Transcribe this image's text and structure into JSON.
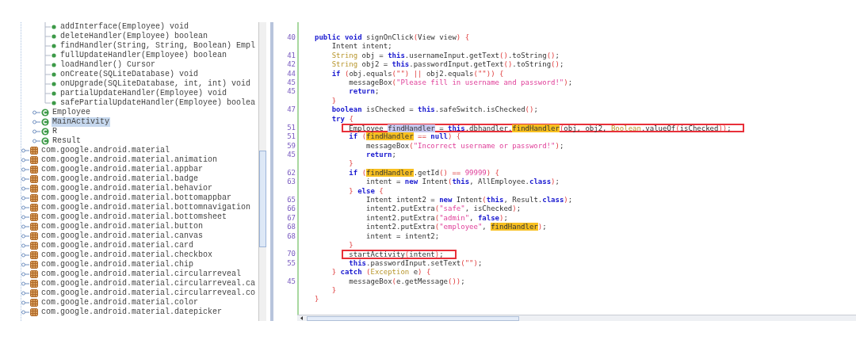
{
  "tree": {
    "items": [
      {
        "children": [
          {
            "children": [
              {
                "label": "addInterface(Employee) void",
                "kind": "method"
              },
              {
                "label": "deleteHandler(Employee) boolean",
                "kind": "method"
              },
              {
                "label": "findHandler(String, String, Boolean) Empl",
                "kind": "method"
              },
              {
                "label": "fullUpdateHandler(Employee) boolean",
                "kind": "method"
              },
              {
                "label": "loadHandler() Cursor",
                "kind": "method"
              },
              {
                "label": "onCreate(SQLiteDatabase) void",
                "kind": "method"
              },
              {
                "label": "onUpgrade(SQLiteDatabase, int, int) void",
                "kind": "method"
              },
              {
                "label": "partialUpdateHandler(Employee) void",
                "kind": "method"
              },
              {
                "label": "safePartialUpdateHandler(Employee) boolea",
                "kind": "method"
              }
            ]
          },
          {
            "label": "Employee",
            "kind": "class",
            "selected": false
          },
          {
            "label": "MainActivity",
            "kind": "class",
            "selected": true
          },
          {
            "label": "R",
            "kind": "class",
            "selected": false
          },
          {
            "label": "Result",
            "kind": "class",
            "selected": false
          }
        ]
      },
      {
        "label": "com.google.android.material",
        "kind": "package"
      },
      {
        "label": "com.google.android.material.animation",
        "kind": "package"
      },
      {
        "label": "com.google.android.material.appbar",
        "kind": "package"
      },
      {
        "label": "com.google.android.material.badge",
        "kind": "package"
      },
      {
        "label": "com.google.android.material.behavior",
        "kind": "package"
      },
      {
        "label": "com.google.android.material.bottomappbar",
        "kind": "package"
      },
      {
        "label": "com.google.android.material.bottomnavigation",
        "kind": "package"
      },
      {
        "label": "com.google.android.material.bottomsheet",
        "kind": "package"
      },
      {
        "label": "com.google.android.material.button",
        "kind": "package"
      },
      {
        "label": "com.google.android.material.canvas",
        "kind": "package"
      },
      {
        "label": "com.google.android.material.card",
        "kind": "package"
      },
      {
        "label": "com.google.android.material.checkbox",
        "kind": "package"
      },
      {
        "label": "com.google.android.material.chip",
        "kind": "package"
      },
      {
        "label": "com.google.android.material.circularreveal",
        "kind": "package"
      },
      {
        "label": "com.google.android.material.circularreveal.ca",
        "kind": "package"
      },
      {
        "label": "com.google.android.material.circularreveal.co",
        "kind": "package"
      },
      {
        "label": "com.google.android.material.color",
        "kind": "package"
      },
      {
        "label": "com.google.android.material.datepicker",
        "kind": "package"
      }
    ]
  },
  "code": {
    "lines": [
      {
        "number": "40",
        "boxed": false,
        "tokens": [
          {
            "text": "public void ",
            "kind": "keyword"
          },
          {
            "text": "signOnClick",
            "kind": "plain"
          },
          {
            "text": "(",
            "kind": "bracket"
          },
          {
            "text": "View view",
            "kind": "plain"
          },
          {
            "text": ") {",
            "kind": "bracket"
          }
        ]
      },
      {
        "boxed": false,
        "tokens": [
          {
            "text": "    Intent intent;",
            "kind": "plain"
          }
        ]
      },
      {
        "number": "41",
        "boxed": false,
        "tokens": [
          {
            "text": "    String",
            "kind": "type"
          },
          {
            "text": " obj = ",
            "kind": "plain"
          },
          {
            "text": "this",
            "kind": "keyword"
          },
          {
            "text": ".usernameInput.getText",
            "kind": "plain"
          },
          {
            "text": "()",
            "kind": "bracket"
          },
          {
            "text": ".toString",
            "kind": "plain"
          },
          {
            "text": "()",
            "kind": "bracket"
          },
          {
            "text": ";",
            "kind": "plain"
          }
        ]
      },
      {
        "number": "42",
        "boxed": false,
        "tokens": [
          {
            "text": "    String",
            "kind": "type"
          },
          {
            "text": " obj2 = ",
            "kind": "plain"
          },
          {
            "text": "this",
            "kind": "keyword"
          },
          {
            "text": ".passwordInput.getText",
            "kind": "plain"
          },
          {
            "text": "()",
            "kind": "bracket"
          },
          {
            "text": ".toString",
            "kind": "plain"
          },
          {
            "text": "()",
            "kind": "bracket"
          },
          {
            "text": ";",
            "kind": "plain"
          }
        ]
      },
      {
        "number": "44",
        "boxed": false,
        "tokens": [
          {
            "text": "    if ",
            "kind": "keyword"
          },
          {
            "text": "(",
            "kind": "bracket"
          },
          {
            "text": "obj.equals",
            "kind": "plain"
          },
          {
            "text": "(\"\") || ",
            "kind": "bracket"
          },
          {
            "text": "obj2.equals",
            "kind": "plain"
          },
          {
            "text": "(\"\")) {",
            "kind": "bracket"
          }
        ]
      },
      {
        "number": "45",
        "boxed": false,
        "tokens": [
          {
            "text": "        messageBox",
            "kind": "plain"
          },
          {
            "text": "(",
            "kind": "bracket"
          },
          {
            "text": "\"Please fill in username and password!\"",
            "kind": "string"
          },
          {
            "text": ")",
            "kind": "bracket"
          },
          {
            "text": ";",
            "kind": "plain"
          }
        ]
      },
      {
        "number": "45",
        "boxed": false,
        "tokens": [
          {
            "text": "        return",
            "kind": "keyword"
          },
          {
            "text": ";",
            "kind": "plain"
          }
        ]
      },
      {
        "boxed": false,
        "tokens": [
          {
            "text": "    }",
            "kind": "bracket"
          }
        ]
      },
      {
        "number": "47",
        "boxed": false,
        "tokens": [
          {
            "text": "    boolean",
            "kind": "keyword"
          },
          {
            "text": " isChecked = ",
            "kind": "plain"
          },
          {
            "text": "this",
            "kind": "keyword"
          },
          {
            "text": ".safeSwitch.isChecked",
            "kind": "plain"
          },
          {
            "text": "()",
            "kind": "bracket"
          },
          {
            "text": ";",
            "kind": "plain"
          }
        ]
      },
      {
        "boxed": false,
        "tokens": [
          {
            "text": "    try ",
            "kind": "keyword"
          },
          {
            "text": "{",
            "kind": "bracket"
          }
        ]
      },
      {
        "number": "51",
        "boxed": true,
        "tokens": [
          {
            "text": "        Employee ",
            "kind": "plain"
          },
          {
            "text": "findHandler",
            "kind": "selection"
          },
          {
            "text": " = ",
            "kind": "plain"
          },
          {
            "text": "this",
            "kind": "keyword"
          },
          {
            "text": ".dbhandler.",
            "kind": "plain"
          },
          {
            "text": "findHandler",
            "kind": "highlight"
          },
          {
            "text": "(",
            "kind": "bracket"
          },
          {
            "text": "obj, obj2, ",
            "kind": "plain"
          },
          {
            "text": "Boolean",
            "kind": "type"
          },
          {
            "text": ".valueOf",
            "kind": "plain"
          },
          {
            "text": "(",
            "kind": "bracket"
          },
          {
            "text": "isChecked",
            "kind": "plain"
          },
          {
            "text": "))",
            "kind": "bracket"
          },
          {
            "text": ";",
            "kind": "plain"
          }
        ]
      },
      {
        "number": "51",
        "boxed": false,
        "tokens": [
          {
            "text": "        if ",
            "kind": "keyword"
          },
          {
            "text": "(",
            "kind": "bracket"
          },
          {
            "text": "findHandler",
            "kind": "highlight"
          },
          {
            "text": " == ",
            "kind": "bracket"
          },
          {
            "text": "null",
            "kind": "keyword"
          },
          {
            "text": ") {",
            "kind": "bracket"
          }
        ]
      },
      {
        "number": "59",
        "boxed": false,
        "tokens": [
          {
            "text": "            messageBox",
            "kind": "plain"
          },
          {
            "text": "(",
            "kind": "bracket"
          },
          {
            "text": "\"Incorrect username or password!\"",
            "kind": "string"
          },
          {
            "text": ")",
            "kind": "bracket"
          },
          {
            "text": ";",
            "kind": "plain"
          }
        ]
      },
      {
        "number": "45",
        "boxed": false,
        "tokens": [
          {
            "text": "            return",
            "kind": "keyword"
          },
          {
            "text": ";",
            "kind": "plain"
          }
        ]
      },
      {
        "boxed": false,
        "tokens": [
          {
            "text": "        }",
            "kind": "bracket"
          }
        ]
      },
      {
        "number": "62",
        "boxed": false,
        "tokens": [
          {
            "text": "        if ",
            "kind": "keyword"
          },
          {
            "text": "(",
            "kind": "bracket"
          },
          {
            "text": "findHandler",
            "kind": "highlight"
          },
          {
            "text": ".getId",
            "kind": "plain"
          },
          {
            "text": "() == ",
            "kind": "bracket"
          },
          {
            "text": "99999",
            "kind": "number"
          },
          {
            "text": ") {",
            "kind": "bracket"
          }
        ]
      },
      {
        "number": "63",
        "boxed": false,
        "tokens": [
          {
            "text": "            intent = ",
            "kind": "plain"
          },
          {
            "text": "new ",
            "kind": "keyword"
          },
          {
            "text": "Intent",
            "kind": "plain"
          },
          {
            "text": "(",
            "kind": "bracket"
          },
          {
            "text": "this",
            "kind": "keyword"
          },
          {
            "text": ", AllEmployee.",
            "kind": "plain"
          },
          {
            "text": "class",
            "kind": "keyword"
          },
          {
            "text": ")",
            "kind": "bracket"
          },
          {
            "text": ";",
            "kind": "plain"
          }
        ]
      },
      {
        "boxed": false,
        "tokens": [
          {
            "text": "        } ",
            "kind": "bracket"
          },
          {
            "text": "else ",
            "kind": "keyword"
          },
          {
            "text": "{",
            "kind": "bracket"
          }
        ]
      },
      {
        "number": "65",
        "boxed": false,
        "tokens": [
          {
            "text": "            Intent intent2 = ",
            "kind": "plain"
          },
          {
            "text": "new ",
            "kind": "keyword"
          },
          {
            "text": "Intent",
            "kind": "plain"
          },
          {
            "text": "(",
            "kind": "bracket"
          },
          {
            "text": "this",
            "kind": "keyword"
          },
          {
            "text": ", Result.",
            "kind": "plain"
          },
          {
            "text": "class",
            "kind": "keyword"
          },
          {
            "text": ")",
            "kind": "bracket"
          },
          {
            "text": ";",
            "kind": "plain"
          }
        ]
      },
      {
        "number": "66",
        "boxed": false,
        "tokens": [
          {
            "text": "            intent2.putExtra",
            "kind": "plain"
          },
          {
            "text": "(",
            "kind": "bracket"
          },
          {
            "text": "\"safe\"",
            "kind": "string"
          },
          {
            "text": ", isChecked",
            "kind": "plain"
          },
          {
            "text": ")",
            "kind": "bracket"
          },
          {
            "text": ";",
            "kind": "plain"
          }
        ]
      },
      {
        "number": "67",
        "boxed": false,
        "tokens": [
          {
            "text": "            intent2.putExtra",
            "kind": "plain"
          },
          {
            "text": "(",
            "kind": "bracket"
          },
          {
            "text": "\"admin\"",
            "kind": "string"
          },
          {
            "text": ", ",
            "kind": "plain"
          },
          {
            "text": "false",
            "kind": "keyword"
          },
          {
            "text": ")",
            "kind": "bracket"
          },
          {
            "text": ";",
            "kind": "plain"
          }
        ]
      },
      {
        "number": "68",
        "boxed": false,
        "tokens": [
          {
            "text": "            intent2.putExtra",
            "kind": "plain"
          },
          {
            "text": "(",
            "kind": "bracket"
          },
          {
            "text": "\"employee\"",
            "kind": "string"
          },
          {
            "text": ", ",
            "kind": "plain"
          },
          {
            "text": "findHandler",
            "kind": "highlight"
          },
          {
            "text": ")",
            "kind": "bracket"
          },
          {
            "text": ";",
            "kind": "plain"
          }
        ]
      },
      {
        "number": "68",
        "boxed": false,
        "tokens": [
          {
            "text": "            intent = intent2;",
            "kind": "plain"
          }
        ]
      },
      {
        "boxed": false,
        "tokens": [
          {
            "text": "        }",
            "kind": "bracket"
          }
        ]
      },
      {
        "number": "70",
        "boxed": true,
        "tokens": [
          {
            "text": "        startActivity",
            "kind": "plain"
          },
          {
            "text": "(",
            "kind": "bracket"
          },
          {
            "text": "intent",
            "kind": "plain"
          },
          {
            "text": ")",
            "kind": "bracket"
          },
          {
            "text": ";",
            "kind": "plain"
          }
        ]
      },
      {
        "number": "55",
        "boxed": false,
        "tokens": [
          {
            "text": "        this",
            "kind": "keyword"
          },
          {
            "text": ".passwordInput.setText",
            "kind": "plain"
          },
          {
            "text": "(\"\")",
            "kind": "bracket"
          },
          {
            "text": ";",
            "kind": "plain"
          }
        ]
      },
      {
        "boxed": false,
        "tokens": [
          {
            "text": "    } ",
            "kind": "bracket"
          },
          {
            "text": "catch ",
            "kind": "keyword"
          },
          {
            "text": "(",
            "kind": "bracket"
          },
          {
            "text": "Exception",
            "kind": "type"
          },
          {
            "text": " e",
            "kind": "plain"
          },
          {
            "text": ") {",
            "kind": "bracket"
          }
        ]
      },
      {
        "number": "45",
        "boxed": false,
        "tokens": [
          {
            "text": "        messageBox",
            "kind": "plain"
          },
          {
            "text": "(",
            "kind": "bracket"
          },
          {
            "text": "e.getMessage",
            "kind": "plain"
          },
          {
            "text": "())",
            "kind": "bracket"
          },
          {
            "text": ";",
            "kind": "plain"
          }
        ]
      },
      {
        "boxed": false,
        "tokens": [
          {
            "text": "    }",
            "kind": "bracket"
          }
        ]
      },
      {
        "boxed": false,
        "tokens": [
          {
            "text": "}",
            "kind": "bracket"
          }
        ]
      }
    ]
  }
}
